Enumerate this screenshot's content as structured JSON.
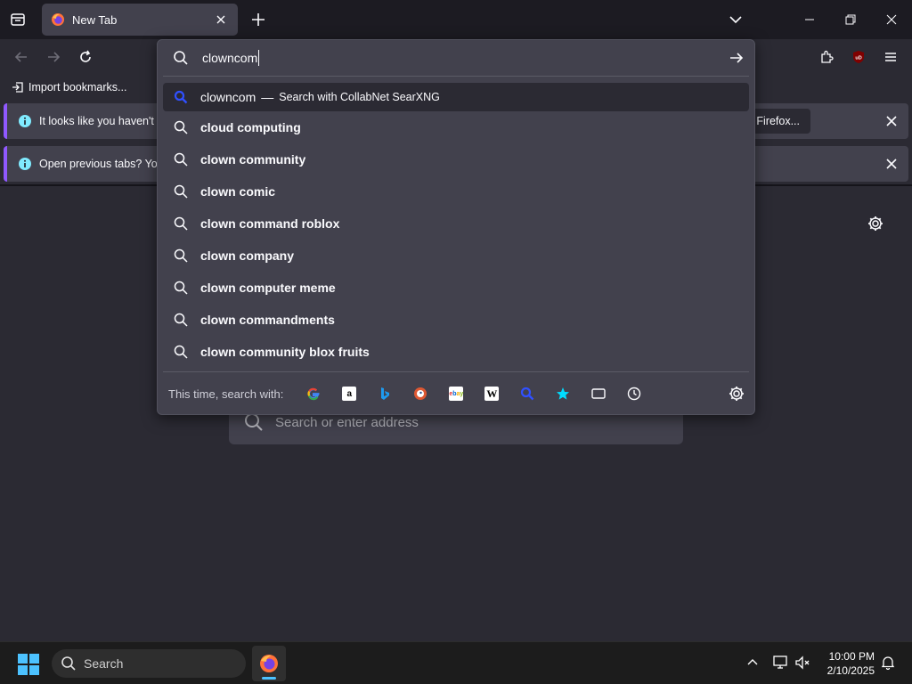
{
  "tab": {
    "title": "New Tab"
  },
  "bookmarks": {
    "import_label": "Import bookmarks..."
  },
  "notifications": [
    {
      "text": "It looks like you haven't st",
      "action_label": "n Firefox..."
    },
    {
      "text": "Open previous tabs? You c"
    }
  ],
  "urlbar": {
    "value": "clowncom",
    "heuristic": {
      "query": "clowncom",
      "separator": "—",
      "action": "Search with CollabNet SearXNG"
    },
    "suggestions": [
      "cloud computing",
      "clown community",
      "clown comic",
      "clown command roblox",
      "clown company",
      "clown computer meme",
      "clown commandments",
      "clown community blox fruits"
    ],
    "oneoff_label": "This time, search with:",
    "engines": [
      "google-icon",
      "amazon-icon",
      "bing-icon",
      "duckduckgo-icon",
      "ebay-icon",
      "wikipedia-icon",
      "searxng-icon",
      "bookmarks-icon",
      "tabs-icon",
      "history-icon"
    ]
  },
  "page": {
    "search_placeholder": "Search or enter address"
  },
  "taskbar": {
    "search_label": "Search",
    "time": "10:00 PM",
    "date": "2/10/2025"
  },
  "colors": {
    "accent": "#9059ff",
    "selected_row": "#2b2a33",
    "panel": "#42414d",
    "searx_blue": "#3050ff"
  }
}
